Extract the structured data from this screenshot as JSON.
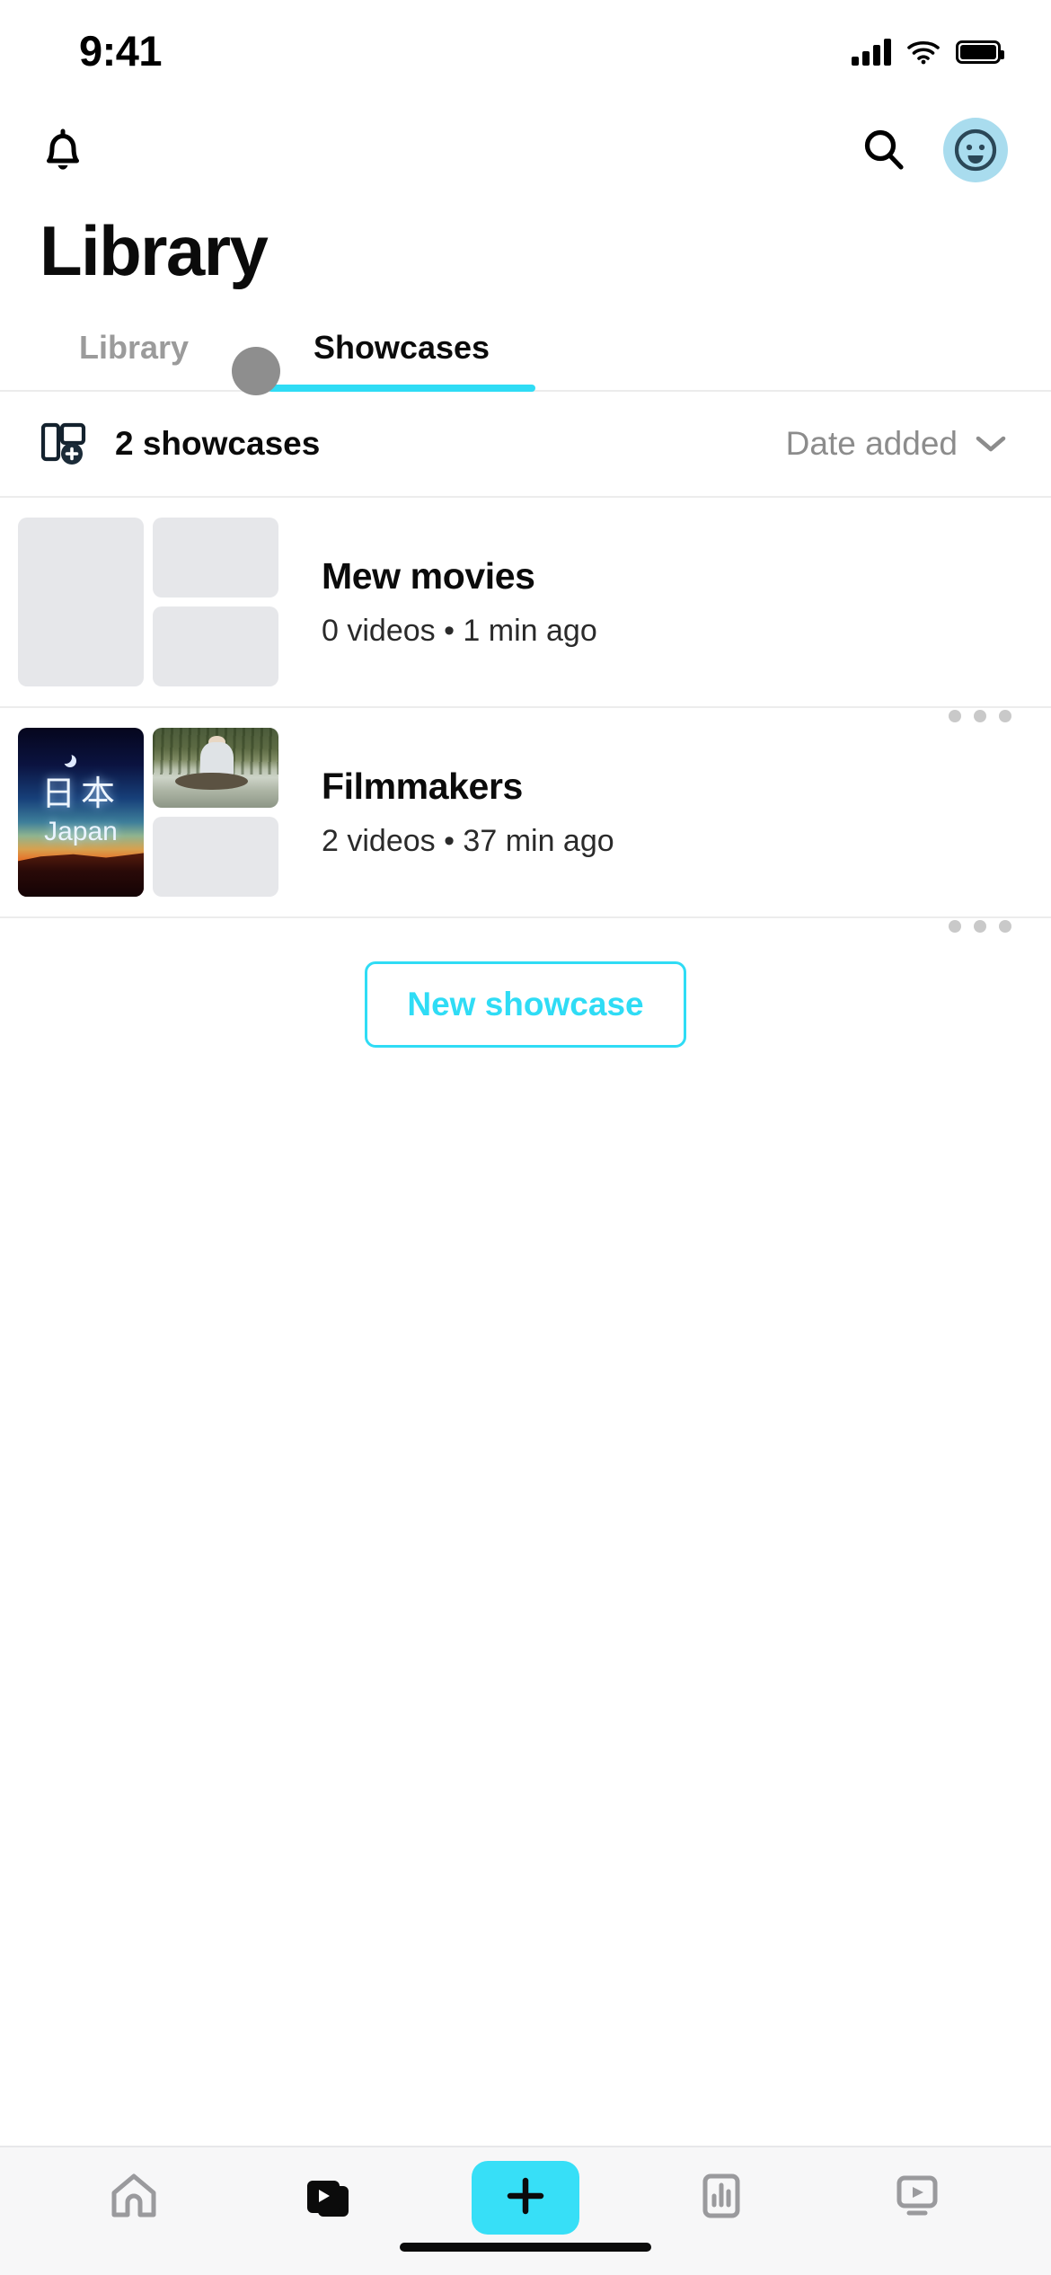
{
  "status_bar": {
    "time": "9:41",
    "signal_icon": "cellular-signal-icon",
    "wifi_icon": "wifi-icon",
    "battery_icon": "battery-icon"
  },
  "header": {
    "notifications_icon": "bell-icon",
    "search_icon": "search-icon",
    "avatar_icon": "avatar-smiley-icon",
    "avatar_bg": "#a9dcee",
    "title": "Library"
  },
  "tabs": {
    "items": [
      {
        "label": "Library",
        "active": false
      },
      {
        "label": "Showcases",
        "active": true
      }
    ],
    "active_underline_color": "#2fdcf5"
  },
  "toolbar": {
    "add_showcase_icon": "add-showcase-icon",
    "count_label": "2 showcases",
    "sort_label": "Date added",
    "sort_chevron_icon": "chevron-down-icon"
  },
  "showcases": [
    {
      "title": "Mew movies",
      "subtitle": "0 videos • 1 min ago",
      "more_icon": "more-options-icon",
      "thumbs": {
        "main": "placeholder",
        "top": "placeholder",
        "bottom": "placeholder"
      }
    },
    {
      "title": "Filmmakers",
      "subtitle": "2 videos • 37 min ago",
      "more_icon": "more-options-icon",
      "thumbs": {
        "main": "japan-poster",
        "top": "fishing-photo",
        "bottom": "placeholder"
      },
      "poster_kanji": "日本",
      "poster_romaji": "Japan"
    }
  ],
  "new_showcase": {
    "label": "New showcase",
    "accent": "#2fdcf5"
  },
  "tab_bar": {
    "items": [
      {
        "name": "home",
        "icon": "home-icon",
        "active": false
      },
      {
        "name": "library",
        "icon": "video-library-icon",
        "active": true
      },
      {
        "name": "create",
        "icon": "plus-icon",
        "active": false
      },
      {
        "name": "analytics",
        "icon": "bar-chart-icon",
        "active": false
      },
      {
        "name": "watch",
        "icon": "screen-play-icon",
        "active": false
      }
    ],
    "create_bg": "#37dff7"
  }
}
